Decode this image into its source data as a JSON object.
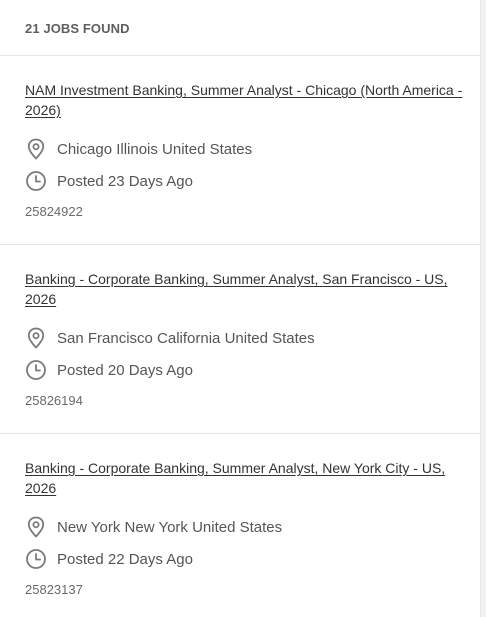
{
  "results": {
    "count_label": "21 JOBS FOUND"
  },
  "jobs": [
    {
      "title": "NAM Investment Banking, Summer Analyst - Chicago (North America - 2026)",
      "location": "Chicago Illinois United States",
      "posted": "Posted 23 Days Ago",
      "job_id": "25824922"
    },
    {
      "title": "Banking - Corporate Banking, Summer Analyst, San Francisco - US, 2026",
      "location": "San Francisco California United States",
      "posted": "Posted 20 Days Ago",
      "job_id": "25826194"
    },
    {
      "title": "Banking - Corporate Banking, Summer Analyst, New York City - US, 2026",
      "location": "New York New York United States",
      "posted": "Posted 22 Days Ago",
      "job_id": "25823137"
    }
  ],
  "icons": {
    "location": "location-pin-icon",
    "posted": "clock-icon"
  },
  "colors": {
    "text_primary": "#333333",
    "text_secondary": "#555555",
    "icon_gray": "#7a7a7a",
    "divider": "#e3e3e3"
  }
}
